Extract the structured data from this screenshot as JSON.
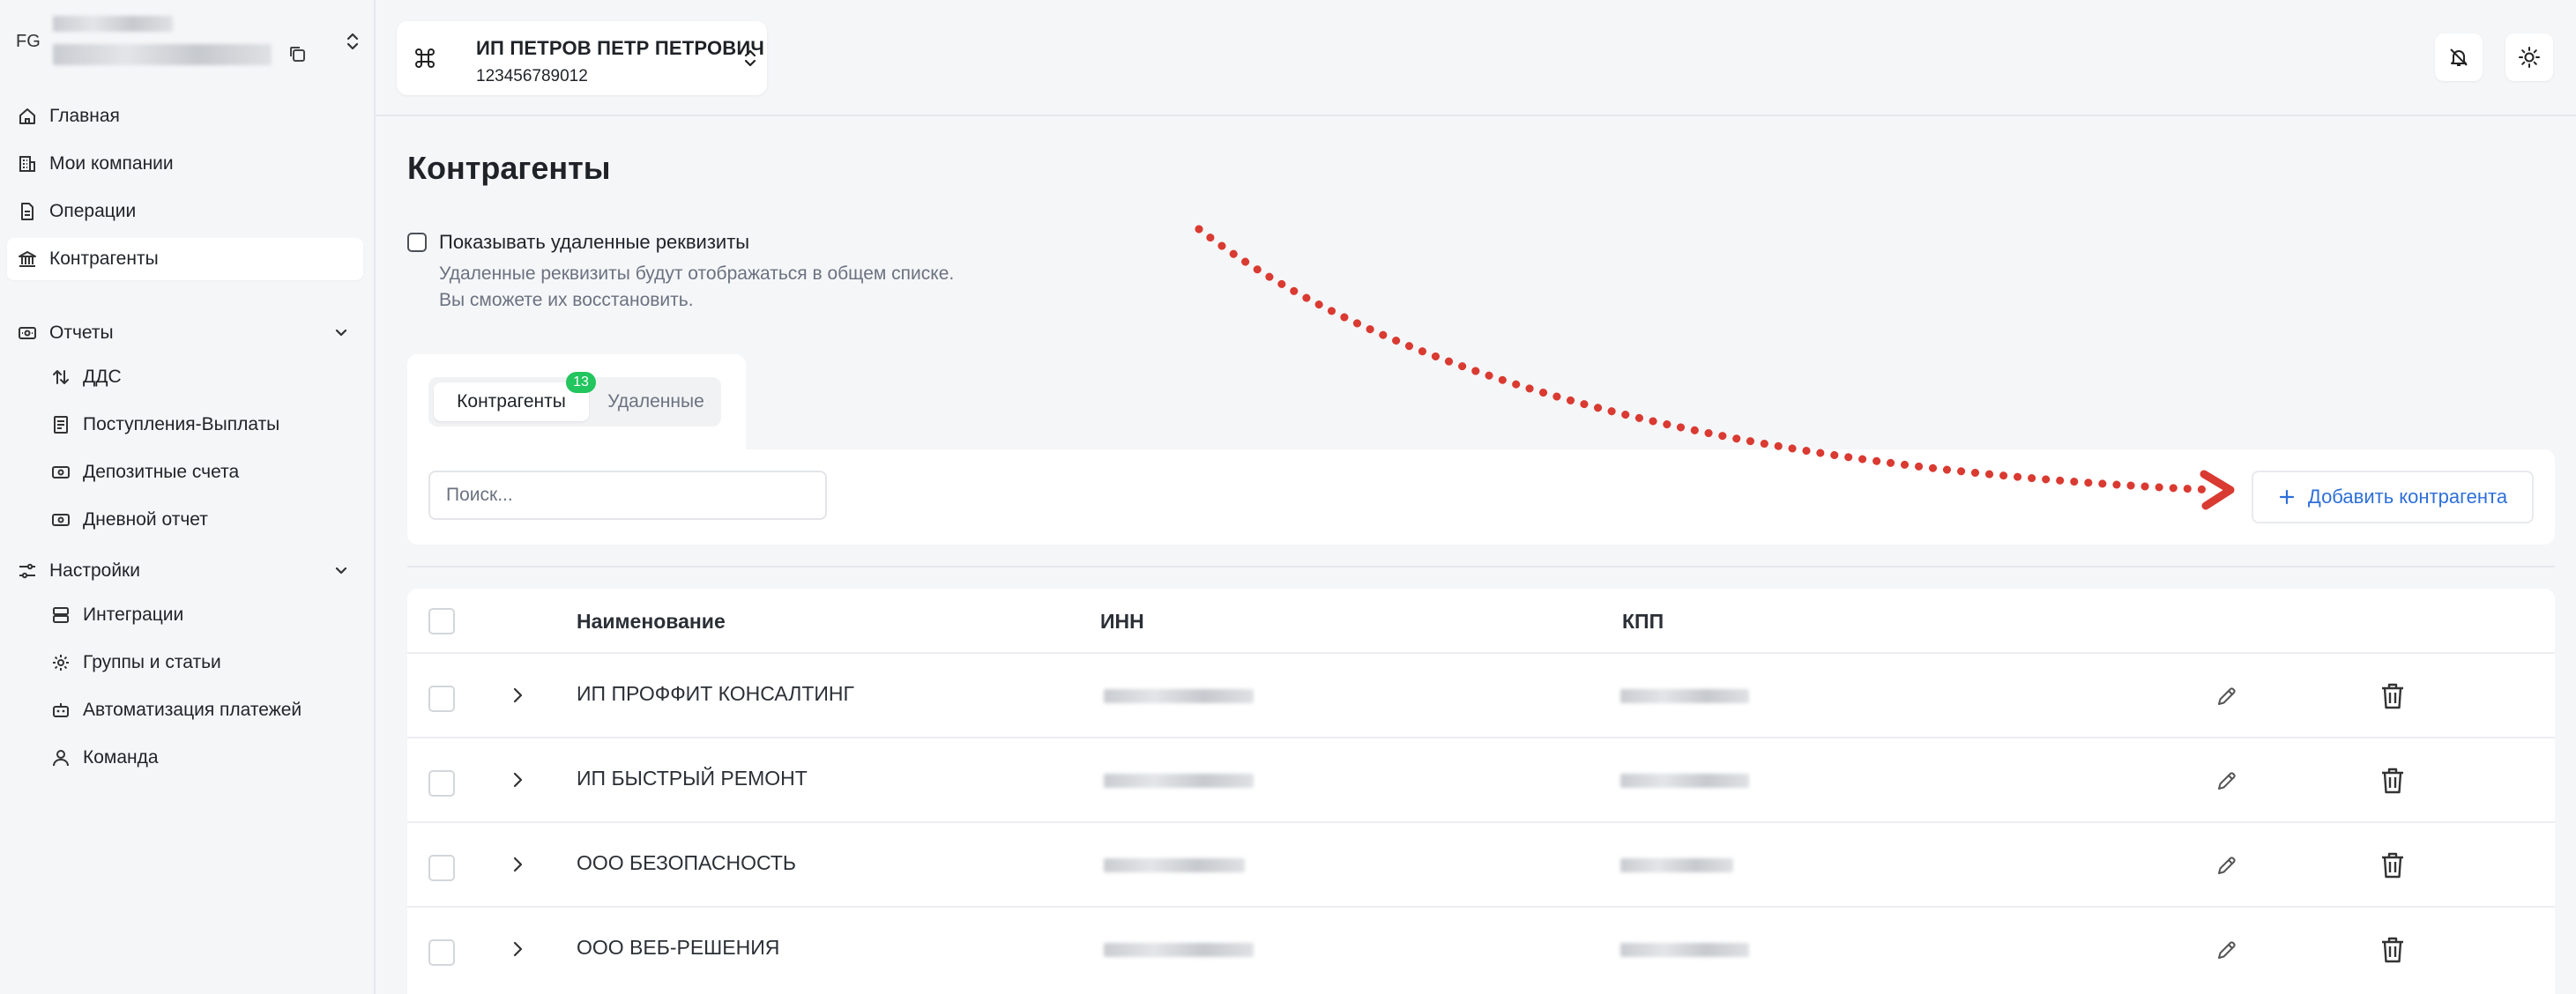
{
  "account": {
    "initials": "FG"
  },
  "sidebar": {
    "items": [
      {
        "label": "Главная"
      },
      {
        "label": "Мои компании"
      },
      {
        "label": "Операции"
      },
      {
        "label": "Контрагенты"
      }
    ],
    "reports": {
      "label": "Отчеты",
      "items": [
        {
          "label": "ДДС"
        },
        {
          "label": "Поступления-Выплаты"
        },
        {
          "label": "Депозитные счета"
        },
        {
          "label": "Дневной отчет"
        }
      ]
    },
    "settings": {
      "label": "Настройки",
      "items": [
        {
          "label": "Интеграции"
        },
        {
          "label": "Группы и статьи"
        },
        {
          "label": "Автоматизация платежей"
        },
        {
          "label": "Команда"
        }
      ]
    }
  },
  "header": {
    "company_name": "ИП ПЕТРОВ ПЕТР ПЕТРОВИЧ",
    "company_inn": "123456789012"
  },
  "page": {
    "title": "Контрагенты",
    "show_deleted_label": "Показывать удаленные реквизиты",
    "show_deleted_hint_1": "Удаленные реквизиты будут отображаться в общем списке.",
    "show_deleted_hint_2": "Вы сможете их восстановить.",
    "tabs": [
      {
        "label": "Контрагенты",
        "badge": "13"
      },
      {
        "label": "Удаленные"
      }
    ],
    "search_placeholder": "Поиск...",
    "add_button_label": "Добавить контрагента"
  },
  "table": {
    "columns": [
      "Наименование",
      "ИНН",
      "КПП"
    ],
    "rows": [
      {
        "name": "ИП ПРОФФИТ КОНСАЛТИНГ"
      },
      {
        "name": "ИП БЫСТРЫЙ РЕМОНТ"
      },
      {
        "name": "ООО БЕЗОПАСНОСТЬ"
      },
      {
        "name": "ООО ВЕБ-РЕШЕНИЯ"
      }
    ]
  },
  "colors": {
    "accent": "#2e6fd8",
    "badge": "#22c55e",
    "annotation": "#d93a31"
  }
}
